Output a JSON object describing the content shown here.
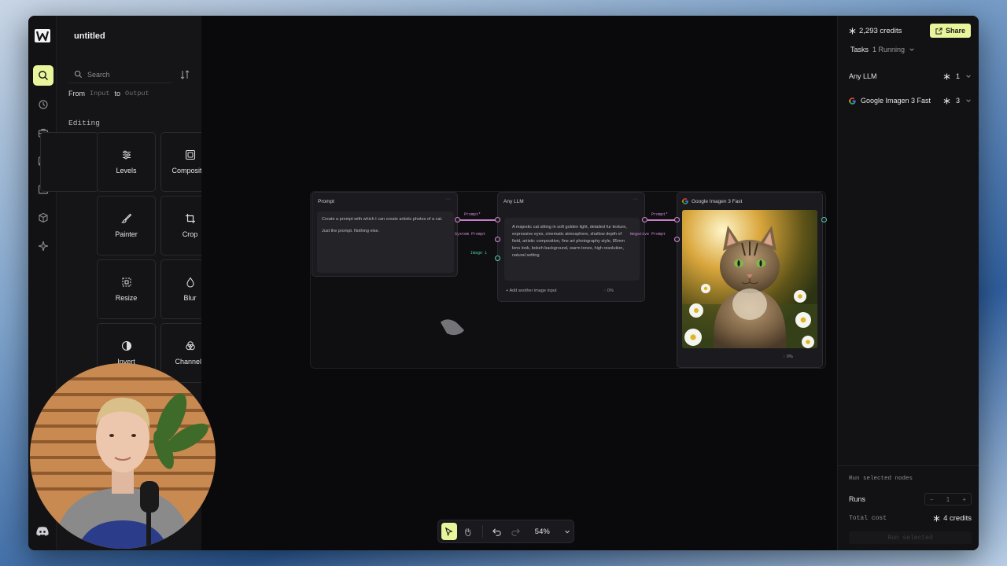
{
  "app": {
    "project_title": "untitled"
  },
  "sidebar": {
    "search_placeholder": "Search",
    "filter": {
      "from": "From",
      "input": "Input",
      "to": "to",
      "output": "Output"
    },
    "section": "Editing",
    "tools": [
      {
        "label": "Levels",
        "icon": "levels-icon"
      },
      {
        "label": "Compositor",
        "icon": "compositor-icon"
      },
      {
        "label": "Painter",
        "icon": "painter-icon"
      },
      {
        "label": "Crop",
        "icon": "crop-icon"
      },
      {
        "label": "Resize",
        "icon": "resize-icon"
      },
      {
        "label": "Blur",
        "icon": "blur-icon"
      },
      {
        "label": "Invert",
        "icon": "invert-icon"
      },
      {
        "label": "Channels",
        "icon": "channels-icon"
      }
    ]
  },
  "canvas": {
    "nodes": {
      "prompt": {
        "title": "Prompt",
        "text_line1": "Create a prompt with which I can create artistic photos of a cat.",
        "text_line2": "Just the prompt. Nothing else."
      },
      "llm": {
        "title": "Any LLM",
        "in_prompt": "Prompt*",
        "in_system": "System Prompt",
        "in_image": "Image 1",
        "output_text": "A majestic cat sitting in soft golden light, detailed fur texture, expressive eyes, cinematic atmosphere, shallow depth of field, artistic composition, fine art photography style, 85mm lens look, bokeh background, warm tones, high resolution, natural setting",
        "add_image": "Add another image input",
        "progress": "0%"
      },
      "imagen": {
        "title": "Google Imagen 3 Fast",
        "in_prompt": "Prompt*",
        "in_negative": "Negative Prompt",
        "progress": "0%"
      }
    }
  },
  "toolbar": {
    "zoom": "54%"
  },
  "rpanel": {
    "credits": "2,293 credits",
    "share": "Share",
    "tasks_label": "Tasks",
    "tasks_status": "1 Running",
    "models": [
      {
        "name": "Any LLM",
        "count": "1"
      },
      {
        "name": "Google Imagen 3 Fast",
        "count": "3"
      }
    ],
    "run_selected_label": "Run selected nodes",
    "runs_label": "Runs",
    "runs_value": "1",
    "total_cost_label": "Total cost",
    "total_cost_value": "4 credits",
    "run_button": "Run selected"
  },
  "colors": {
    "accent": "#e9f59a",
    "port_pink": "#d98ad6",
    "port_teal": "#55c9a7"
  }
}
